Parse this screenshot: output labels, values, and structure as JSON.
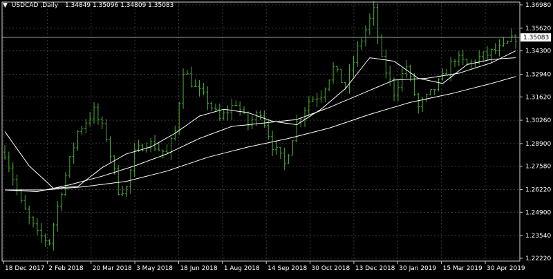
{
  "header": {
    "symbol": "USDCAD",
    "timeframe": "Daily",
    "ohlc": "1.34849 1.35096 1.34809 1.35083"
  },
  "colors": {
    "background": "#000000",
    "grid": "#3a3a3a",
    "border": "#cfcfcf",
    "bar": "#4caf3a",
    "ma": "#ffffff",
    "price_line": "#8a8a8a",
    "current_label_bg": "#ffffff",
    "current_label_text": "#000000",
    "text": "#ffffff"
  },
  "chart_data": {
    "type": "line",
    "series_style": "ohlc-bars",
    "ylim": [
      1.2222,
      1.3698
    ],
    "y_ticks": [
      1.3698,
      1.3562,
      1.343,
      1.3294,
      1.3162,
      1.3026,
      1.289,
      1.2758,
      1.2622,
      1.249,
      1.2354,
      1.2222
    ],
    "y_tick_labels": [
      "1.36980",
      "1.35620",
      "1.34300",
      "1.32940",
      "1.31620",
      "1.30260",
      "1.28900",
      "1.27580",
      "1.26220",
      "1.24900",
      "1.23540",
      "1.22220"
    ],
    "x_labels": [
      "18 Dec 2017",
      "2 Feb 2018",
      "20 Mar 2018",
      "3 May 2018",
      "18 Jun 2018",
      "1 Aug 2018",
      "14 Sep 2018",
      "30 Oct 2018",
      "13 Dec 2018",
      "30 Jan 2019",
      "15 Mar 2019",
      "30 Apr 2019"
    ],
    "current_price": 1.35083,
    "current_price_label": "1.35083",
    "bar_count": 127,
    "close_anchors": [
      [
        0,
        1.284
      ],
      [
        4,
        1.254
      ],
      [
        8,
        1.236
      ],
      [
        11,
        1.232
      ],
      [
        14,
        1.262
      ],
      [
        18,
        1.296
      ],
      [
        22,
        1.308
      ],
      [
        25,
        1.293
      ],
      [
        28,
        1.262
      ],
      [
        30,
        1.263
      ],
      [
        32,
        1.283
      ],
      [
        35,
        1.29
      ],
      [
        38,
        1.286
      ],
      [
        40,
        1.283
      ],
      [
        42,
        1.296
      ],
      [
        44,
        1.332
      ],
      [
        47,
        1.321
      ],
      [
        50,
        1.314
      ],
      [
        53,
        1.303
      ],
      [
        57,
        1.313
      ],
      [
        60,
        1.3
      ],
      [
        63,
        1.308
      ],
      [
        66,
        1.288
      ],
      [
        69,
        1.277
      ],
      [
        72,
        1.301
      ],
      [
        75,
        1.314
      ],
      [
        78,
        1.318
      ],
      [
        81,
        1.333
      ],
      [
        84,
        1.322
      ],
      [
        87,
        1.344
      ],
      [
        90,
        1.361
      ],
      [
        91,
        1.366
      ],
      [
        93,
        1.337
      ],
      [
        96,
        1.319
      ],
      [
        99,
        1.334
      ],
      [
        102,
        1.31
      ],
      [
        105,
        1.318
      ],
      [
        108,
        1.327
      ],
      [
        111,
        1.339
      ],
      [
        114,
        1.335
      ],
      [
        117,
        1.339
      ],
      [
        120,
        1.342
      ],
      [
        123,
        1.345
      ],
      [
        126,
        1.351
      ]
    ],
    "moving_averages": [
      {
        "period": 20,
        "values": [
          [
            0,
            1.296
          ],
          [
            6,
            1.276
          ],
          [
            12,
            1.263
          ],
          [
            18,
            1.264
          ],
          [
            24,
            1.275
          ],
          [
            30,
            1.283
          ],
          [
            36,
            1.287
          ],
          [
            42,
            1.295
          ],
          [
            48,
            1.305
          ],
          [
            54,
            1.309
          ],
          [
            60,
            1.307
          ],
          [
            66,
            1.302
          ],
          [
            72,
            1.3
          ],
          [
            78,
            1.309
          ],
          [
            84,
            1.321
          ],
          [
            90,
            1.339
          ],
          [
            96,
            1.337
          ],
          [
            102,
            1.327
          ],
          [
            108,
            1.324
          ],
          [
            114,
            1.335
          ],
          [
            120,
            1.338
          ],
          [
            126,
            1.339
          ]
        ]
      },
      {
        "period": 50,
        "values": [
          [
            0,
            1.262
          ],
          [
            8,
            1.261
          ],
          [
            16,
            1.265
          ],
          [
            24,
            1.27
          ],
          [
            32,
            1.276
          ],
          [
            40,
            1.283
          ],
          [
            48,
            1.292
          ],
          [
            56,
            1.299
          ],
          [
            64,
            1.301
          ],
          [
            72,
            1.303
          ],
          [
            80,
            1.31
          ],
          [
            88,
            1.318
          ],
          [
            96,
            1.326
          ],
          [
            104,
            1.327
          ],
          [
            112,
            1.33
          ],
          [
            120,
            1.336
          ],
          [
            126,
            1.343
          ]
        ]
      },
      {
        "period": 200,
        "values": [
          [
            0,
            1.262
          ],
          [
            10,
            1.262
          ],
          [
            20,
            1.264
          ],
          [
            30,
            1.267
          ],
          [
            40,
            1.273
          ],
          [
            50,
            1.281
          ],
          [
            60,
            1.287
          ],
          [
            70,
            1.292
          ],
          [
            80,
            1.298
          ],
          [
            90,
            1.306
          ],
          [
            100,
            1.313
          ],
          [
            110,
            1.318
          ],
          [
            120,
            1.324
          ],
          [
            126,
            1.328
          ]
        ]
      }
    ]
  }
}
